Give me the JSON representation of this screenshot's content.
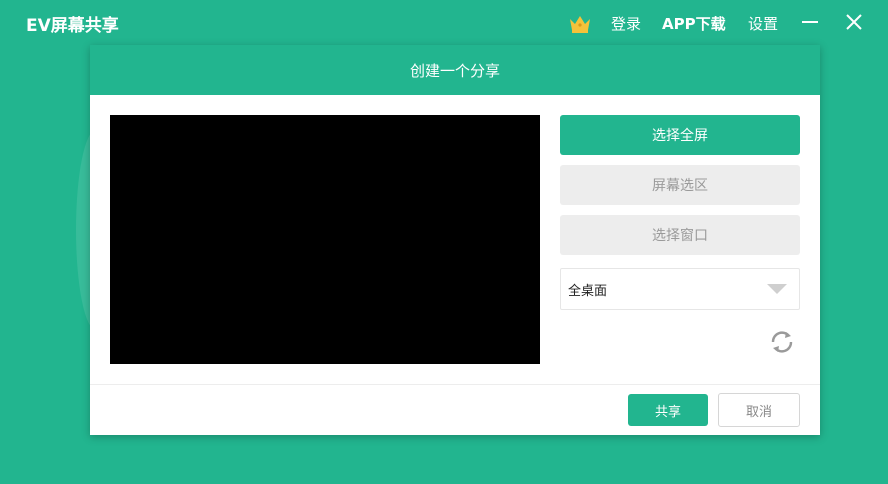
{
  "app": {
    "title": "EV屏幕共享"
  },
  "topbar": {
    "crown_icon": "crown-icon",
    "login_label": "登录",
    "app_download_label": "APP下载",
    "settings_label": "设置",
    "minimize_icon": "minimize-icon",
    "close_icon": "close-icon"
  },
  "dialog": {
    "title": "创建一个分享",
    "buttons": {
      "select_fullscreen": "选择全屏",
      "screen_region": "屏幕选区",
      "select_window": "选择窗口"
    },
    "display_select": {
      "value": "全桌面"
    },
    "refresh_icon": "refresh-icon",
    "footer": {
      "share": "共享",
      "cancel": "取消"
    }
  },
  "colors": {
    "accent": "#22b58f",
    "crown": "#f5c23a",
    "disabled_bg": "#ededed"
  }
}
